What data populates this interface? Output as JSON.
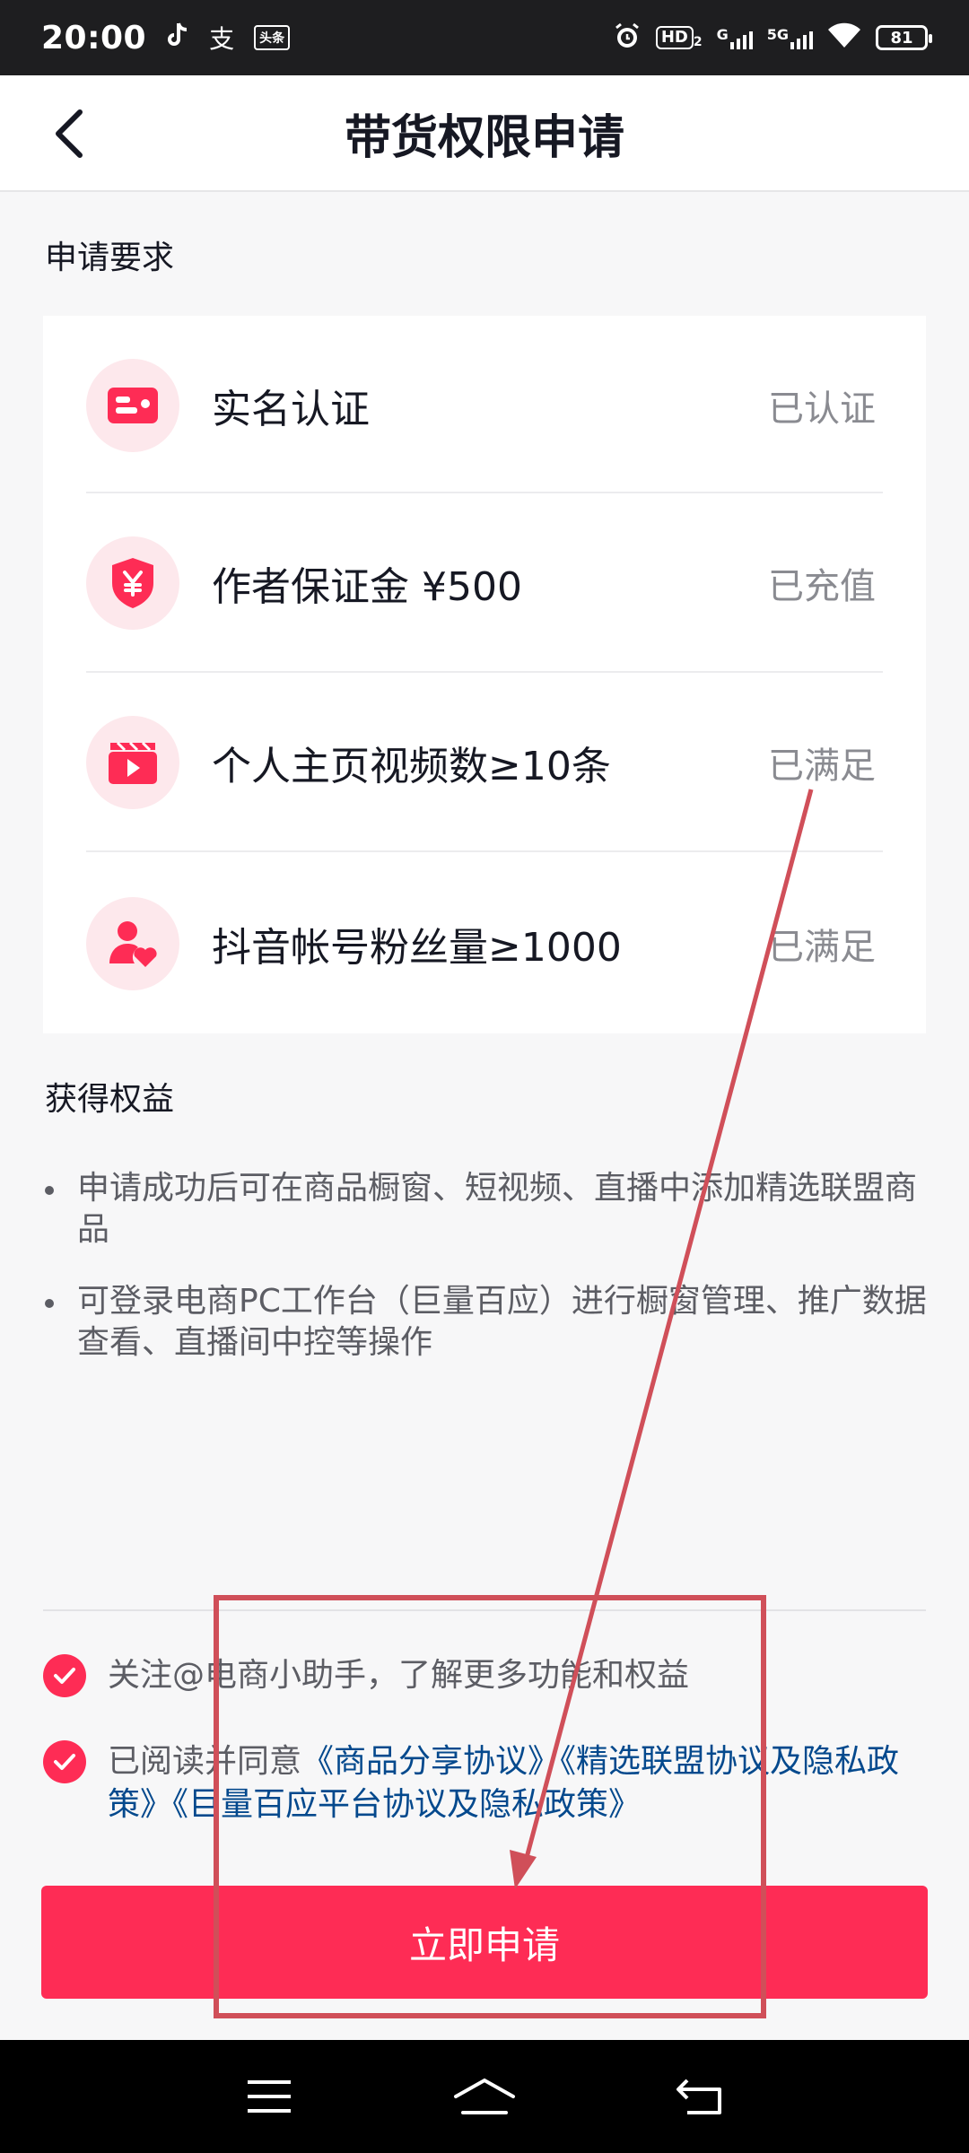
{
  "status_bar": {
    "time": "20:00",
    "notif_icons": [
      "tiktok-icon",
      "alipay-icon",
      "toutiao-icon"
    ],
    "alipay_char": "支",
    "toutiao_label": "头条",
    "hd_label": "HD",
    "hd_sub": "2",
    "net1": "G",
    "net2": "5G",
    "battery": "81"
  },
  "nav": {
    "title": "带货权限申请"
  },
  "requirements": {
    "section_title": "申请要求",
    "items": [
      {
        "label": "实名认证",
        "status": "已认证",
        "icon": "id-card-icon"
      },
      {
        "label": "作者保证金 ¥500",
        "status": "已充值",
        "icon": "yuan-shield-icon"
      },
      {
        "label": "个人主页视频数≥10条",
        "status": "已满足",
        "icon": "video-clapper-icon"
      },
      {
        "label": "抖音帐号粉丝量≥1000",
        "status": "已满足",
        "icon": "fans-heart-icon"
      }
    ]
  },
  "benefits": {
    "section_title": "获得权益",
    "items": [
      "申请成功后可在商品橱窗、短视频、直播中添加精选联盟商品",
      "可登录电商PC工作台（巨量百应）进行橱窗管理、推广数据查看、直播间中控等操作"
    ]
  },
  "agreements": {
    "follow_text": "关注@电商小助手，了解更多功能和权益",
    "read_prefix": "已阅读并同意",
    "links": [
      "《商品分享协议》",
      "《精选联盟协议及隐私政策》",
      "《巨量百应平台协议及隐私政策》"
    ]
  },
  "apply_button": "立即申请",
  "colors": {
    "accent": "#fe2c55",
    "link": "#04498d",
    "annotation": "#d04f59"
  }
}
